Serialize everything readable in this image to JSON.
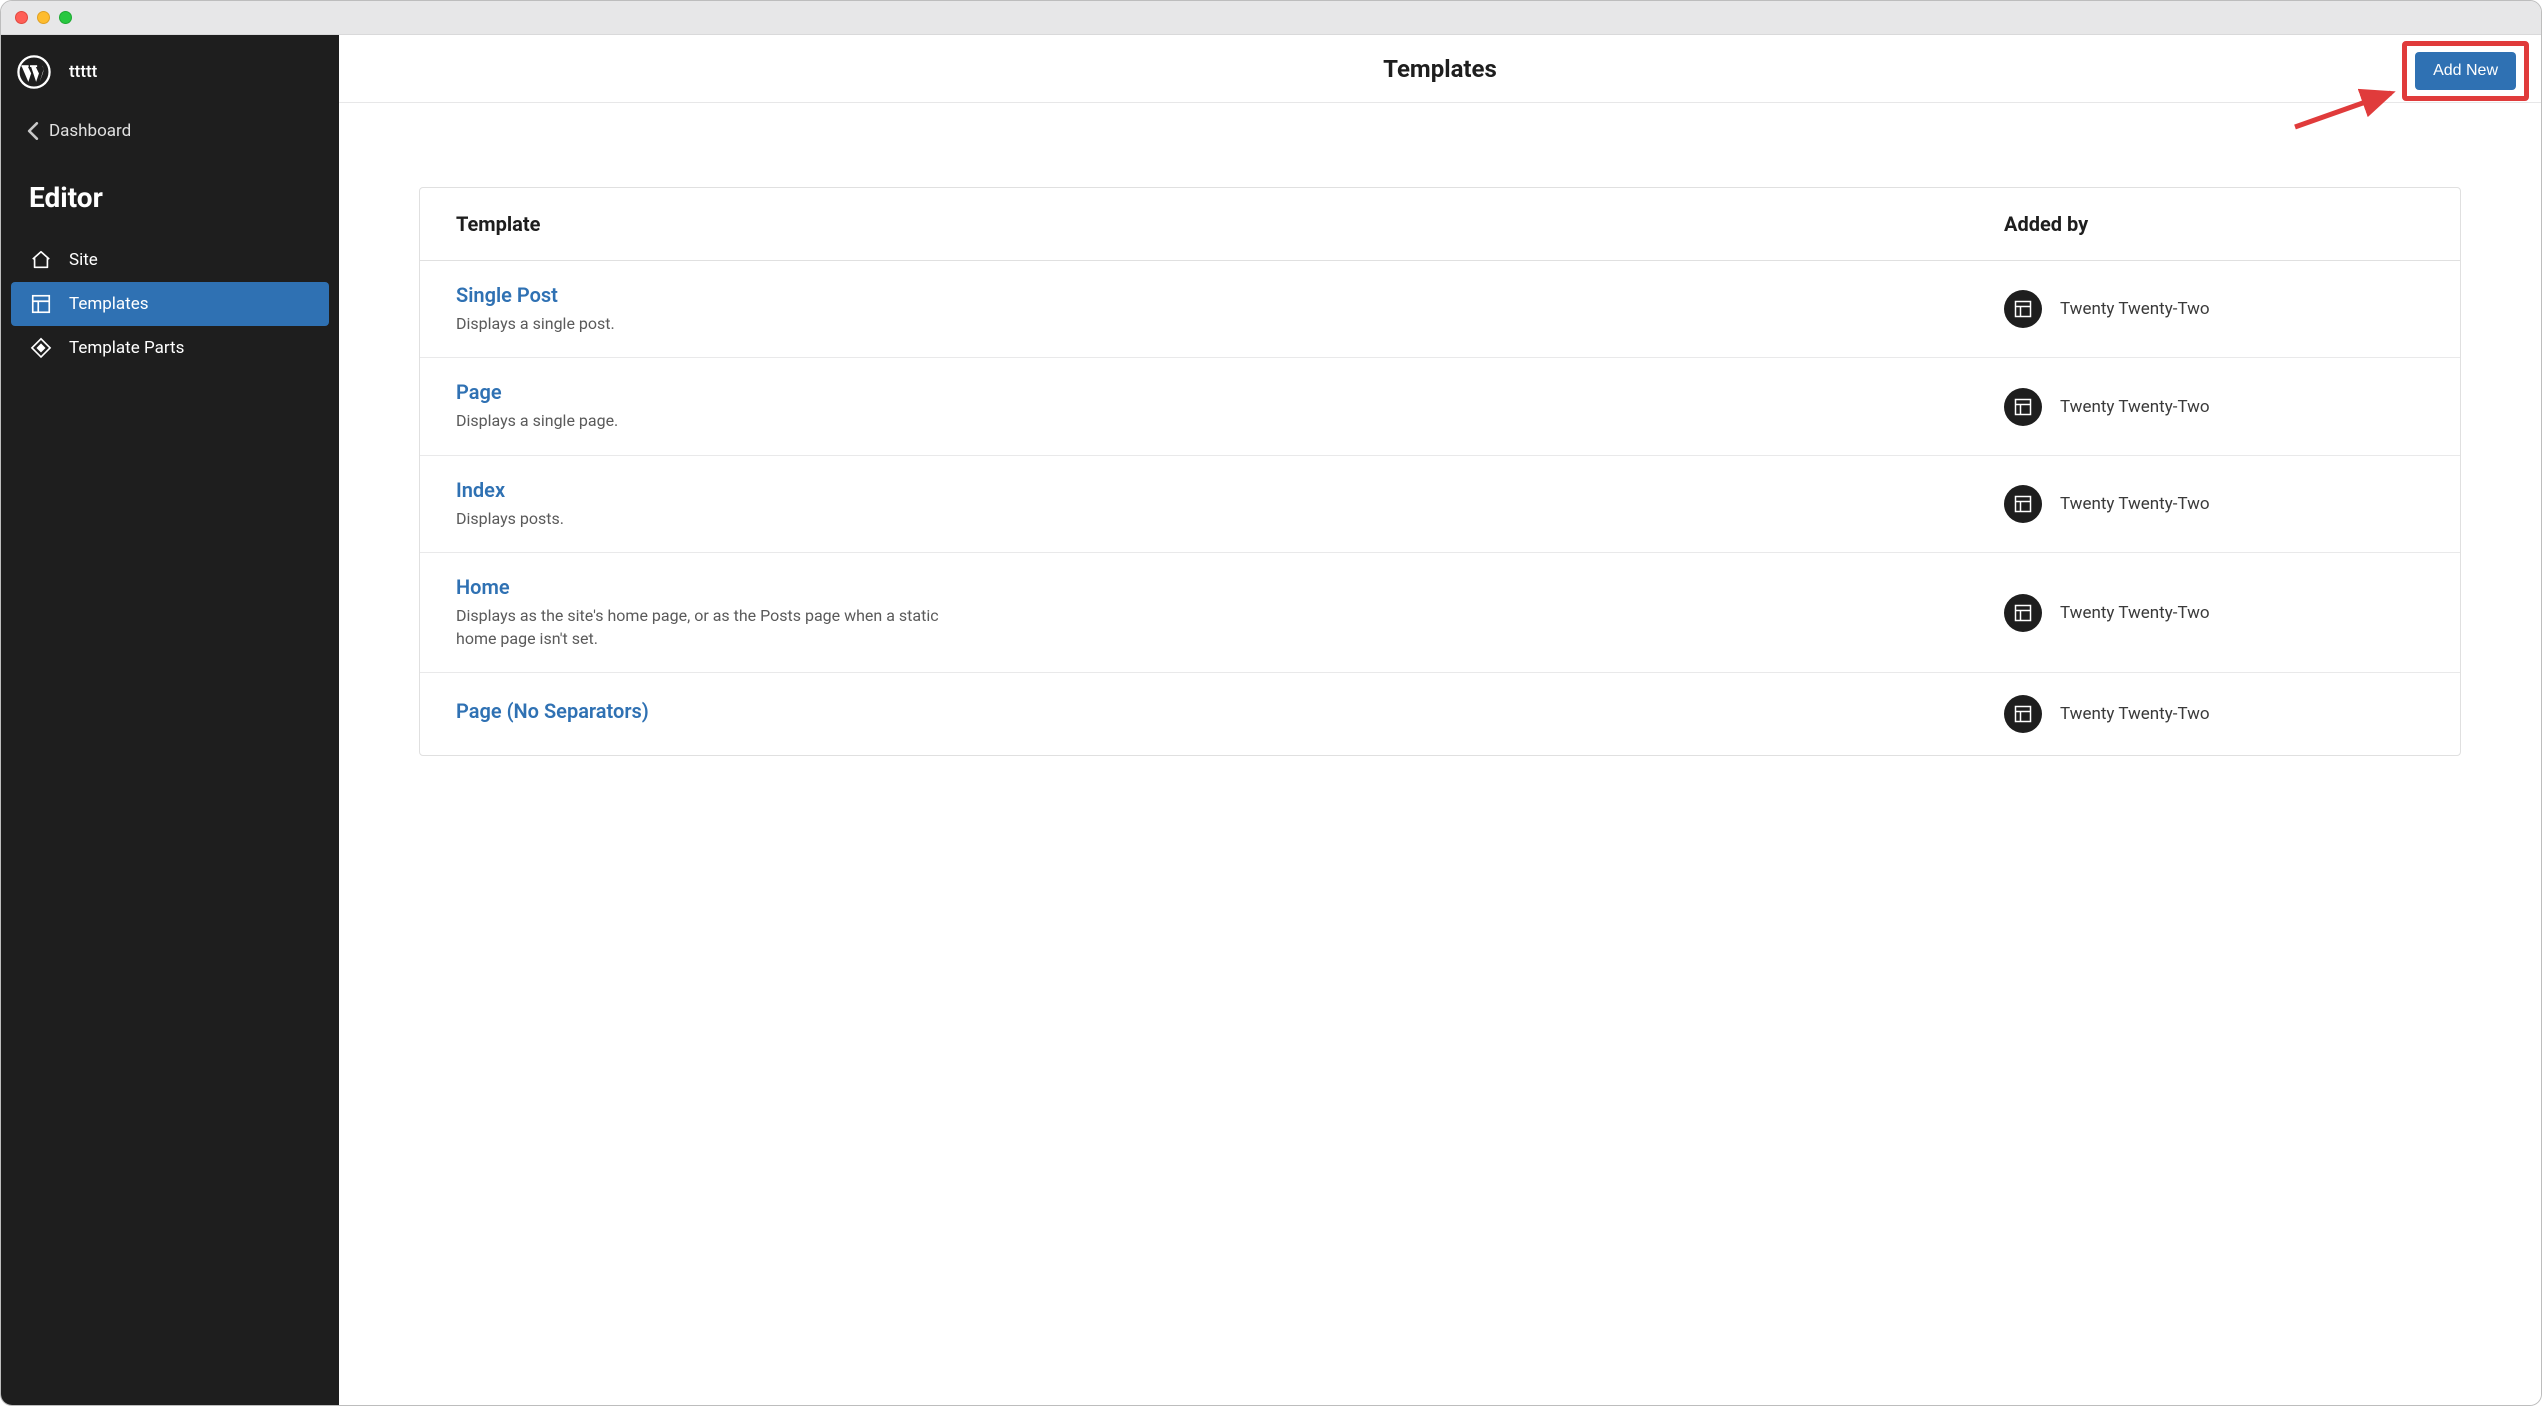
{
  "site": {
    "name": "ttttt"
  },
  "sidebar": {
    "back_label": "Dashboard",
    "section_title": "Editor",
    "items": [
      {
        "label": "Site",
        "icon": "home-icon",
        "active": false
      },
      {
        "label": "Templates",
        "icon": "layout-icon",
        "active": true
      },
      {
        "label": "Template Parts",
        "icon": "diamond-icon",
        "active": false
      }
    ]
  },
  "header": {
    "title": "Templates",
    "add_new_label": "Add New"
  },
  "table": {
    "col_template": "Template",
    "col_added_by": "Added by",
    "rows": [
      {
        "name": "Single Post",
        "desc": "Displays a single post.",
        "added_by": "Twenty Twenty-Two"
      },
      {
        "name": "Page",
        "desc": "Displays a single page.",
        "added_by": "Twenty Twenty-Two"
      },
      {
        "name": "Index",
        "desc": "Displays posts.",
        "added_by": "Twenty Twenty-Two"
      },
      {
        "name": "Home",
        "desc": "Displays as the site's home page, or as the Posts page when a static home page isn't set.",
        "added_by": "Twenty Twenty-Two"
      },
      {
        "name": "Page (No Separators)",
        "desc": "",
        "added_by": "Twenty Twenty-Two"
      }
    ]
  }
}
